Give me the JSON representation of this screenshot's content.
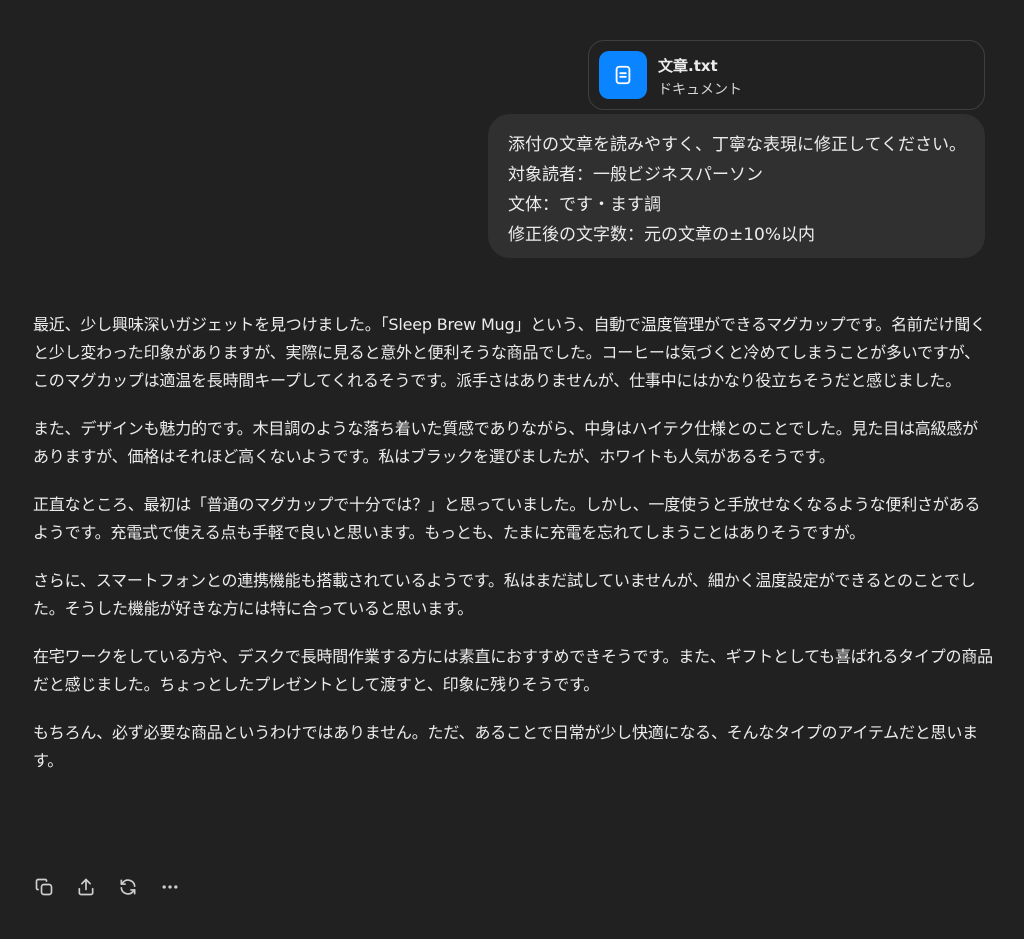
{
  "attachment": {
    "file_name": "文章.txt",
    "file_type": "ドキュメント",
    "icon": "document-icon",
    "accent": "#0a84ff"
  },
  "user_message": {
    "lines": [
      "添付の文章を読みやすく、丁寧な表現に修正してください。",
      "対象読者：一般ビジネスパーソン",
      "文体：です・ます調",
      "修正後の文字数：元の文章の±10%以内"
    ]
  },
  "assistant_response": {
    "paragraphs": [
      "最近、少し興味深いガジェットを見つけました。「Sleep Brew Mug」という、自動で温度管理ができるマグカップです。名前だけ聞くと少し変わった印象がありますが、実際に見ると意外と便利そうな商品でした。コーヒーは気づくと冷めてしまうことが多いですが、このマグカップは適温を長時間キープしてくれるそうです。派手さはありませんが、仕事中にはかなり役立ちそうだと感じました。",
      "また、デザインも魅力的です。木目調のような落ち着いた質感でありながら、中身はハイテク仕様とのことでした。見た目は高級感がありますが、価格はそれほど高くないようです。私はブラックを選びましたが、ホワイトも人気があるそうです。",
      "正直なところ、最初は「普通のマグカップで十分では？」と思っていました。しかし、一度使うと手放せなくなるような便利さがあるようです。充電式で使える点も手軽で良いと思います。もっとも、たまに充電を忘れてしまうことはありそうですが。",
      "さらに、スマートフォンとの連携機能も搭載されているようです。私はまだ試していませんが、細かく温度設定ができるとのことでした。そうした機能が好きな方には特に合っていると思います。",
      "在宅ワークをしている方や、デスクで長時間作業する方には素直におすすめできそうです。また、ギフトとしても喜ばれるタイプの商品だと感じました。ちょっとしたプレゼントとして渡すと、印象に残りそうです。",
      "もちろん、必ず必要な商品というわけではありません。ただ、あることで日常が少し快適になる、そんなタイプのアイテムだと思います。"
    ]
  },
  "actions": [
    "copy-icon",
    "share-icon",
    "regenerate-icon",
    "more-icon"
  ]
}
